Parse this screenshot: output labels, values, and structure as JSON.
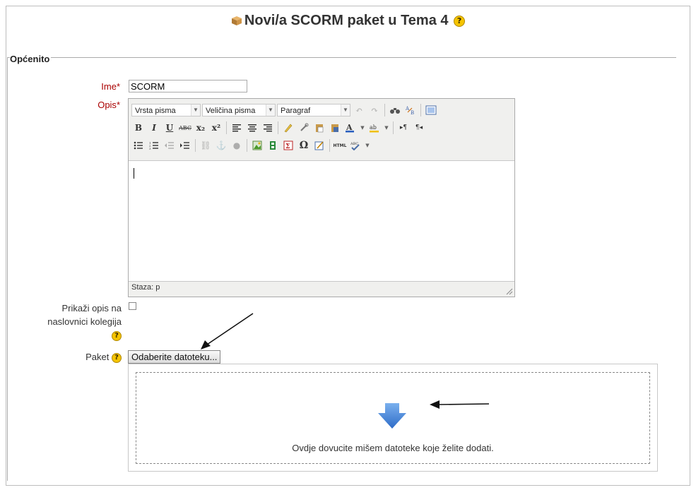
{
  "page": {
    "title": "Novi/a SCORM paket u Tema 4"
  },
  "section": {
    "legend": "Općenito"
  },
  "form": {
    "name": {
      "label": "Ime",
      "required_mark": "*",
      "value": "SCORM"
    },
    "description": {
      "label": "Opis",
      "required_mark": "*"
    },
    "show_description": {
      "label_line1": "Prikaži opis na",
      "label_line2": "naslovnici kolegija",
      "checked": false
    },
    "package": {
      "label": "Paket",
      "button_label": "Odaberite datoteku...",
      "drop_text": "Ovdje dovucite mišem datoteke koje želite dodati."
    }
  },
  "editor": {
    "font_family_label": "Vrsta pisma",
    "font_size_label": "Veličina pisma",
    "format_label": "Paragraf",
    "path_label": "Staza: p",
    "toolbar_row2": [
      "B",
      "I",
      "U",
      "ABC",
      "x₂",
      "x²"
    ],
    "icons": [
      "bold-icon",
      "italic-icon",
      "underline-icon",
      "strikethrough-icon",
      "subscript-icon",
      "superscript-icon",
      "align-left-icon",
      "align-center-icon",
      "align-right-icon",
      "clean-icon",
      "link-icon",
      "paste-icon",
      "paste-word-icon",
      "text-color-icon",
      "highlight-icon",
      "ltr-icon",
      "rtl-icon",
      "bullet-list-icon",
      "numbered-list-icon",
      "outdent-icon",
      "indent-icon",
      "unlink-icon",
      "image-icon",
      "media-icon",
      "equation-icon",
      "special-char-icon",
      "table-icon",
      "html-icon",
      "spellcheck-icon",
      "undo-icon",
      "redo-icon",
      "find-icon",
      "replace-icon",
      "fullscreen-icon"
    ]
  },
  "colors": {
    "required": "#aa0000",
    "help_icon": "#f5c400",
    "drop_arrow": "#4a86d6"
  }
}
